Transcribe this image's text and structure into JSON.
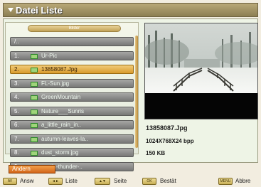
{
  "header": {
    "title": "Datei Liste"
  },
  "list": {
    "folder_label": "Bilder",
    "parent_label": "/..",
    "rows": [
      {
        "num": "1.",
        "name": "Ur-Pic",
        "selected": false
      },
      {
        "num": "2.",
        "name": "13858087.Jpg",
        "selected": true
      },
      {
        "num": "3.",
        "name": "FL-Sun.jpg",
        "selected": false
      },
      {
        "num": "4.",
        "name": "GreenMountain",
        "selected": false
      },
      {
        "num": "5.",
        "name": "Nature___Sunris",
        "selected": false
      },
      {
        "num": "6.",
        "name": "a_little_rain_in..",
        "selected": false
      },
      {
        "num": "7.",
        "name": "autumn-leaves-la..",
        "selected": false
      },
      {
        "num": "8.",
        "name": "dust_storm.jpg",
        "selected": false
      },
      {
        "num": "9.",
        "name": "exotic-thunder-..",
        "selected": false
      }
    ]
  },
  "preview": {
    "filename": "13858087.Jpg",
    "resolution": "1024X768X24 bpp",
    "size": "150 KB"
  },
  "actions": {
    "andern": "Ändern"
  },
  "footer": [
    {
      "key": "AV",
      "label": "Answ"
    },
    {
      "key": "◄►",
      "label": "Liste"
    },
    {
      "key": "▲▼",
      "label": "Seite"
    },
    {
      "key": "OK",
      "label": "Bestät"
    },
    {
      "key": "MENU",
      "label": "Abbre"
    }
  ]
}
